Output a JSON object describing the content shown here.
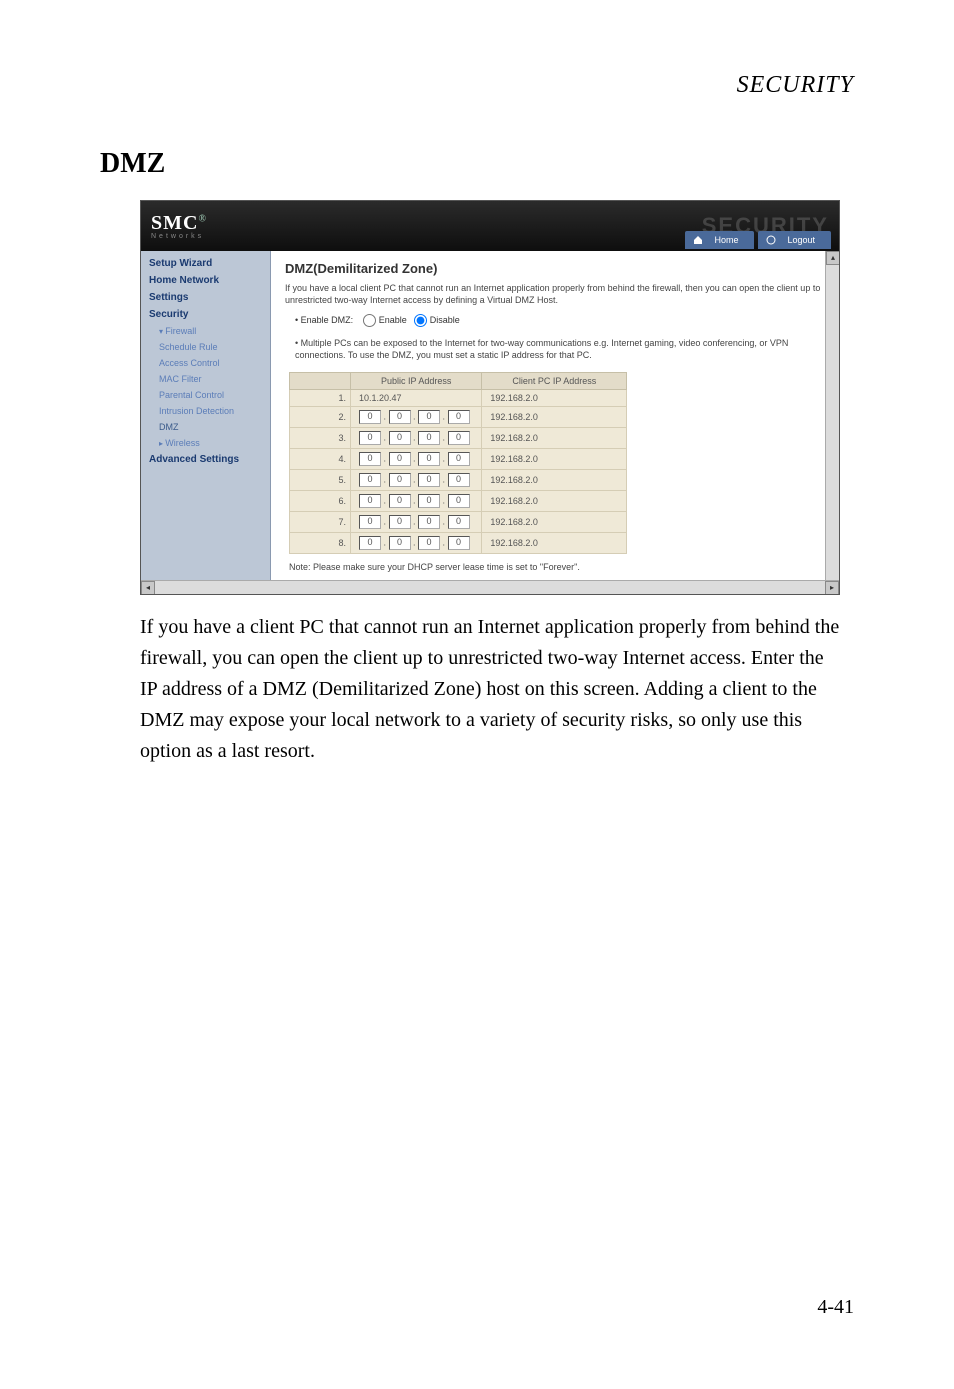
{
  "header": {
    "category": "SECURITY"
  },
  "section": {
    "title": "DMZ"
  },
  "screenshot": {
    "brand": {
      "logo": "SMC",
      "logo_sub": "Networks",
      "watermark": "SECURITY"
    },
    "tabs": {
      "home": "Home",
      "logout": "Logout"
    },
    "nav": {
      "setup_wizard": "Setup Wizard",
      "home_network": "Home Network",
      "settings": "Settings",
      "security": "Security",
      "firewall": "Firewall",
      "schedule_rule": "Schedule Rule",
      "access_control": "Access Control",
      "mac_filter": "MAC Filter",
      "parental_control": "Parental Control",
      "intrusion_detection": "Intrusion Detection",
      "dmz": "DMZ",
      "wireless": "Wireless",
      "advanced_settings": "Advanced Settings"
    },
    "content": {
      "title": "DMZ(Demilitarized Zone)",
      "intro": "If you have a local client PC that cannot run an Internet application properly from behind the firewall, then you can open the client up to unrestricted two-way Internet access by defining a Virtual DMZ Host.",
      "enable_label": "Enable DMZ:",
      "opt_enable": "Enable",
      "opt_disable": "Disable",
      "bullet": "Multiple PCs can be exposed to the Internet for two-way communications e.g. Internet gaming, video conferencing, or VPN connections.  To use the DMZ, you must set a static IP address for that PC.",
      "col_public": "Public IP Address",
      "col_client": "Client PC IP Address",
      "rows": [
        {
          "n": "1.",
          "pub": "10.1.20.47",
          "cli": "192.168.2.0"
        },
        {
          "n": "2.",
          "pub": "0.0.0.0",
          "cli": "192.168.2.0"
        },
        {
          "n": "3.",
          "pub": "0.0.0.0",
          "cli": "192.168.2.0"
        },
        {
          "n": "4.",
          "pub": "0.0.0.0",
          "cli": "192.168.2.0"
        },
        {
          "n": "5.",
          "pub": "0.0.0.0",
          "cli": "192.168.2.0"
        },
        {
          "n": "6.",
          "pub": "0.0.0.0",
          "cli": "192.168.2.0"
        },
        {
          "n": "7.",
          "pub": "0.0.0.0",
          "cli": "192.168.2.0"
        },
        {
          "n": "8.",
          "pub": "0.0.0.0",
          "cli": "192.168.2.0"
        }
      ],
      "note": "Note: Please make sure your DHCP server lease time is set to \"Forever\"."
    }
  },
  "body_text": "If you have a client PC that cannot run an Internet application properly from behind the firewall, you can open the client up to unrestricted two-way Internet access. Enter the IP address of a DMZ (Demilitarized Zone) host on this screen. Adding a client to the DMZ may expose your local network to a variety of security risks, so only use this option as a last resort.",
  "footer": {
    "page": "4-41"
  }
}
